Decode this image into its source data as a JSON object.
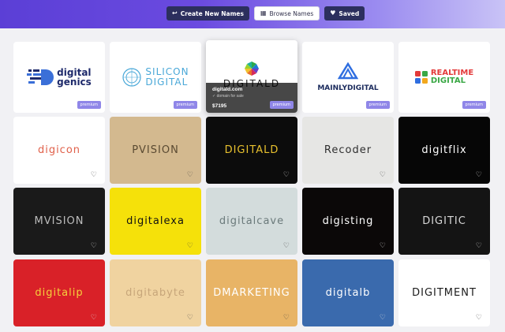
{
  "nav": {
    "create_label": "Create New Names",
    "browse_label": "Browse Names",
    "saved_label": "Saved",
    "create_icon": "↩",
    "browse_icon": "▦",
    "saved_icon": "♥"
  },
  "premium_label": "premium",
  "row0": {
    "digitalgenics": {
      "line1": "digital",
      "line2": "genics"
    },
    "silicondigital": {
      "line1": "SILICON",
      "line2": "DIGITAL"
    },
    "digitald_hover": {
      "wordmark": "DIGITALD",
      "domain": "digitald.com",
      "status": "✓ domain for sale",
      "price": "$7195"
    },
    "mainlydigital": {
      "text": "MAINLYDIGITAL"
    },
    "realtimedigital": {
      "line1": "REALTIME",
      "line2": "DIGITAL"
    }
  },
  "cards": [
    {
      "name": "digicon",
      "text": "digicon",
      "bg": "#ffffff",
      "color": "#e0604a"
    },
    {
      "name": "pvision",
      "text": "PVISION",
      "bg": "#d3b98f",
      "color": "#5a4a32"
    },
    {
      "name": "digitald",
      "text": "DIGITALD",
      "bg": "#0c0c0c",
      "color": "#e8c12e"
    },
    {
      "name": "recoder",
      "text": "Recoder",
      "bg": "#e6e6e4",
      "color": "#2f2f2f"
    },
    {
      "name": "digitflix",
      "text": "digitflix",
      "bg": "#060606",
      "color": "#ffffff"
    },
    {
      "name": "mvision",
      "text": "MVISION",
      "bg": "#1a1a1a",
      "color": "#bdbdbd"
    },
    {
      "name": "digitalexa",
      "text": "digitalexa",
      "bg": "#f5e10a",
      "color": "#121212"
    },
    {
      "name": "digitalcave",
      "text": "digitalcave",
      "bg": "#d3dcdc",
      "color": "#6b7a7b"
    },
    {
      "name": "digisting",
      "text": "digisting",
      "bg": "#0b0808",
      "color": "#ffffff"
    },
    {
      "name": "digitic",
      "text": "DIGITIC",
      "bg": "#141414",
      "color": "#d8d8d8"
    },
    {
      "name": "digitalip",
      "text": "digitalip",
      "bg": "#d92128",
      "color": "#f5d23b"
    },
    {
      "name": "digitabyte",
      "text": "digitabyte",
      "bg": "#f0d3a0",
      "color": "#c7a67a"
    },
    {
      "name": "dmarketing",
      "text": "DMARKETING",
      "bg": "#e8b466",
      "color": "#ffffff"
    },
    {
      "name": "digitalb",
      "text": "digitalb",
      "bg": "#3a6aad",
      "color": "#ffffff"
    },
    {
      "name": "digitment",
      "text": "DIGITMENT",
      "bg": "#ffffff",
      "color": "#1c1c1c"
    }
  ]
}
